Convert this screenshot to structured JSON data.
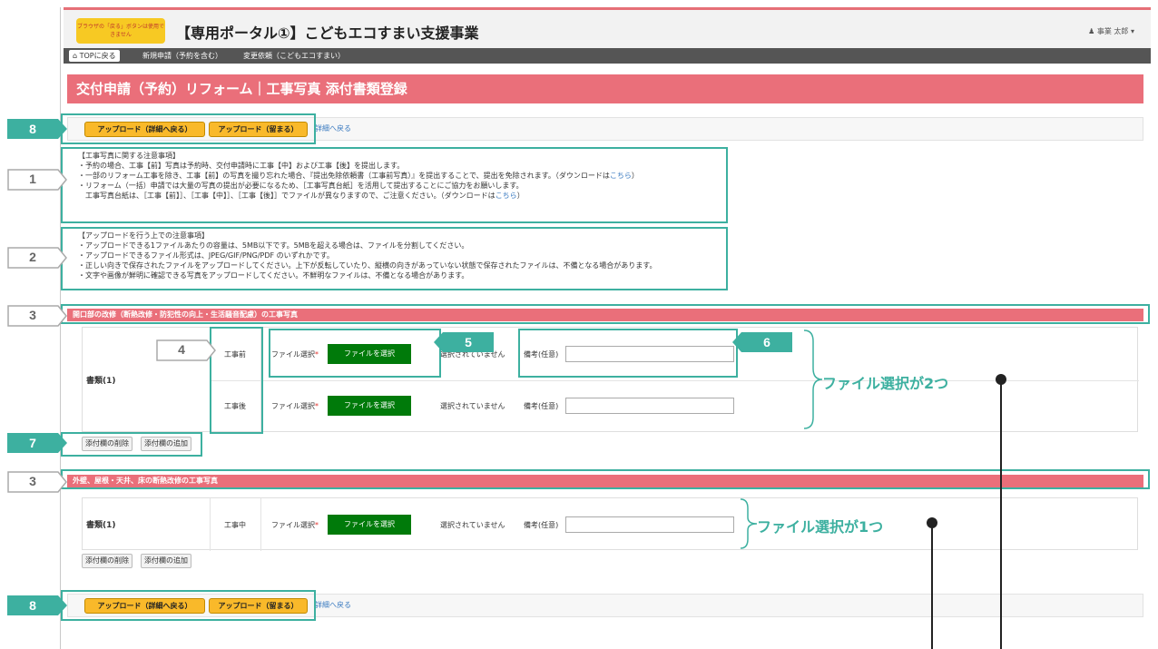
{
  "header": {
    "warning_badge": "ブラウザの「戻る」ボタンは使用できません",
    "app_title": "【専用ポータル①】こどもエコすまい支援事業",
    "user_menu": "事業 太郎 ▾"
  },
  "nav": {
    "top_label": "TOPに戻る",
    "items": [
      "新規申請（予約を含む）",
      "変更依頼（こどもエコすまい）"
    ]
  },
  "page_title": "交付申請（予約）リフォーム｜工事写真 添付書類登録",
  "toolbar": {
    "upload_detail": "アップロード（詳細へ戻る）",
    "upload_stay": "アップロード（留まる）",
    "back_link": "詳細へ戻る"
  },
  "notes1": {
    "heading": "【工事写真に関する注意事項】",
    "lines": [
      "・予約の場合、工事【前】写真は予約時、交付申請時に工事【中】および工事【後】を提出します。",
      "・一部のリフォーム工事を除き、工事【前】の写真を撮り忘れた場合、『提出免除依頼書（工事前写真）』を提出することで、提出を免除されます。（ダウンロードは",
      "・リフォーム（一括）申請では大量の写真の提出が必要になるため、［工事写真台紙］を活用して提出することにご協力をお願いします。",
      "　工事写真台紙は、［工事【前】］、［工事【中】］、［工事【後】］でファイルが異なりますので、ご注意ください。（ダウンロードは"
    ],
    "link": "こちら",
    "close": "）"
  },
  "notes2": {
    "heading": "【アップロードを行う上での注意事項】",
    "lines": [
      "・アップロードできる1ファイルあたりの容量は、5MB以下です。5MBを超える場合は、ファイルを分割してください。",
      "・アップロードできるファイル形式は、JPEG/GIF/PNG/PDF のいずれかです。",
      "・正しい向きで保存されたファイルをアップロードしてください。上下が反転していたり、縦横の向きがあっていない状態で保存されたファイルは、不備となる場合があります。",
      "・文字や画像が鮮明に確認できる写真をアップロードしてください。不鮮明なファイルは、不備となる場合があります。"
    ]
  },
  "section1": {
    "title": "開口部の改修（断熱改修・防犯性の向上・生活騒音配慮）の工事写真",
    "doc_label": "書類(1)",
    "rows": [
      {
        "phase": "工事前",
        "file_label": "ファイル選択",
        "req": "*",
        "button": "ファイルを選択",
        "status": "選択されていません",
        "remark": "備考(任意)"
      },
      {
        "phase": "工事後",
        "file_label": "ファイル選択",
        "req": "*",
        "button": "ファイルを選択",
        "status": "選択されていません",
        "remark": "備考(任意)"
      }
    ],
    "delete_btn": "添付欄の削除",
    "add_btn": "添付欄の追加"
  },
  "section2": {
    "title": "外壁、屋根・天井、床の断熱改修の工事写真",
    "doc_label": "書類(1)",
    "rows": [
      {
        "phase": "工事中",
        "file_label": "ファイル選択",
        "req": "*",
        "button": "ファイルを選択",
        "status": "選択されていません",
        "remark": "備考(任意)"
      }
    ],
    "delete_btn": "添付欄の削除",
    "add_btn": "添付欄の追加"
  },
  "annotations": {
    "callouts": [
      "8",
      "1",
      "2",
      "3",
      "4",
      "5",
      "6",
      "7",
      "3",
      "8"
    ],
    "two_files": "ファイル選択が2つ",
    "one_file": "ファイル選択が1つ",
    "highlight_color": "#3db0a0"
  }
}
